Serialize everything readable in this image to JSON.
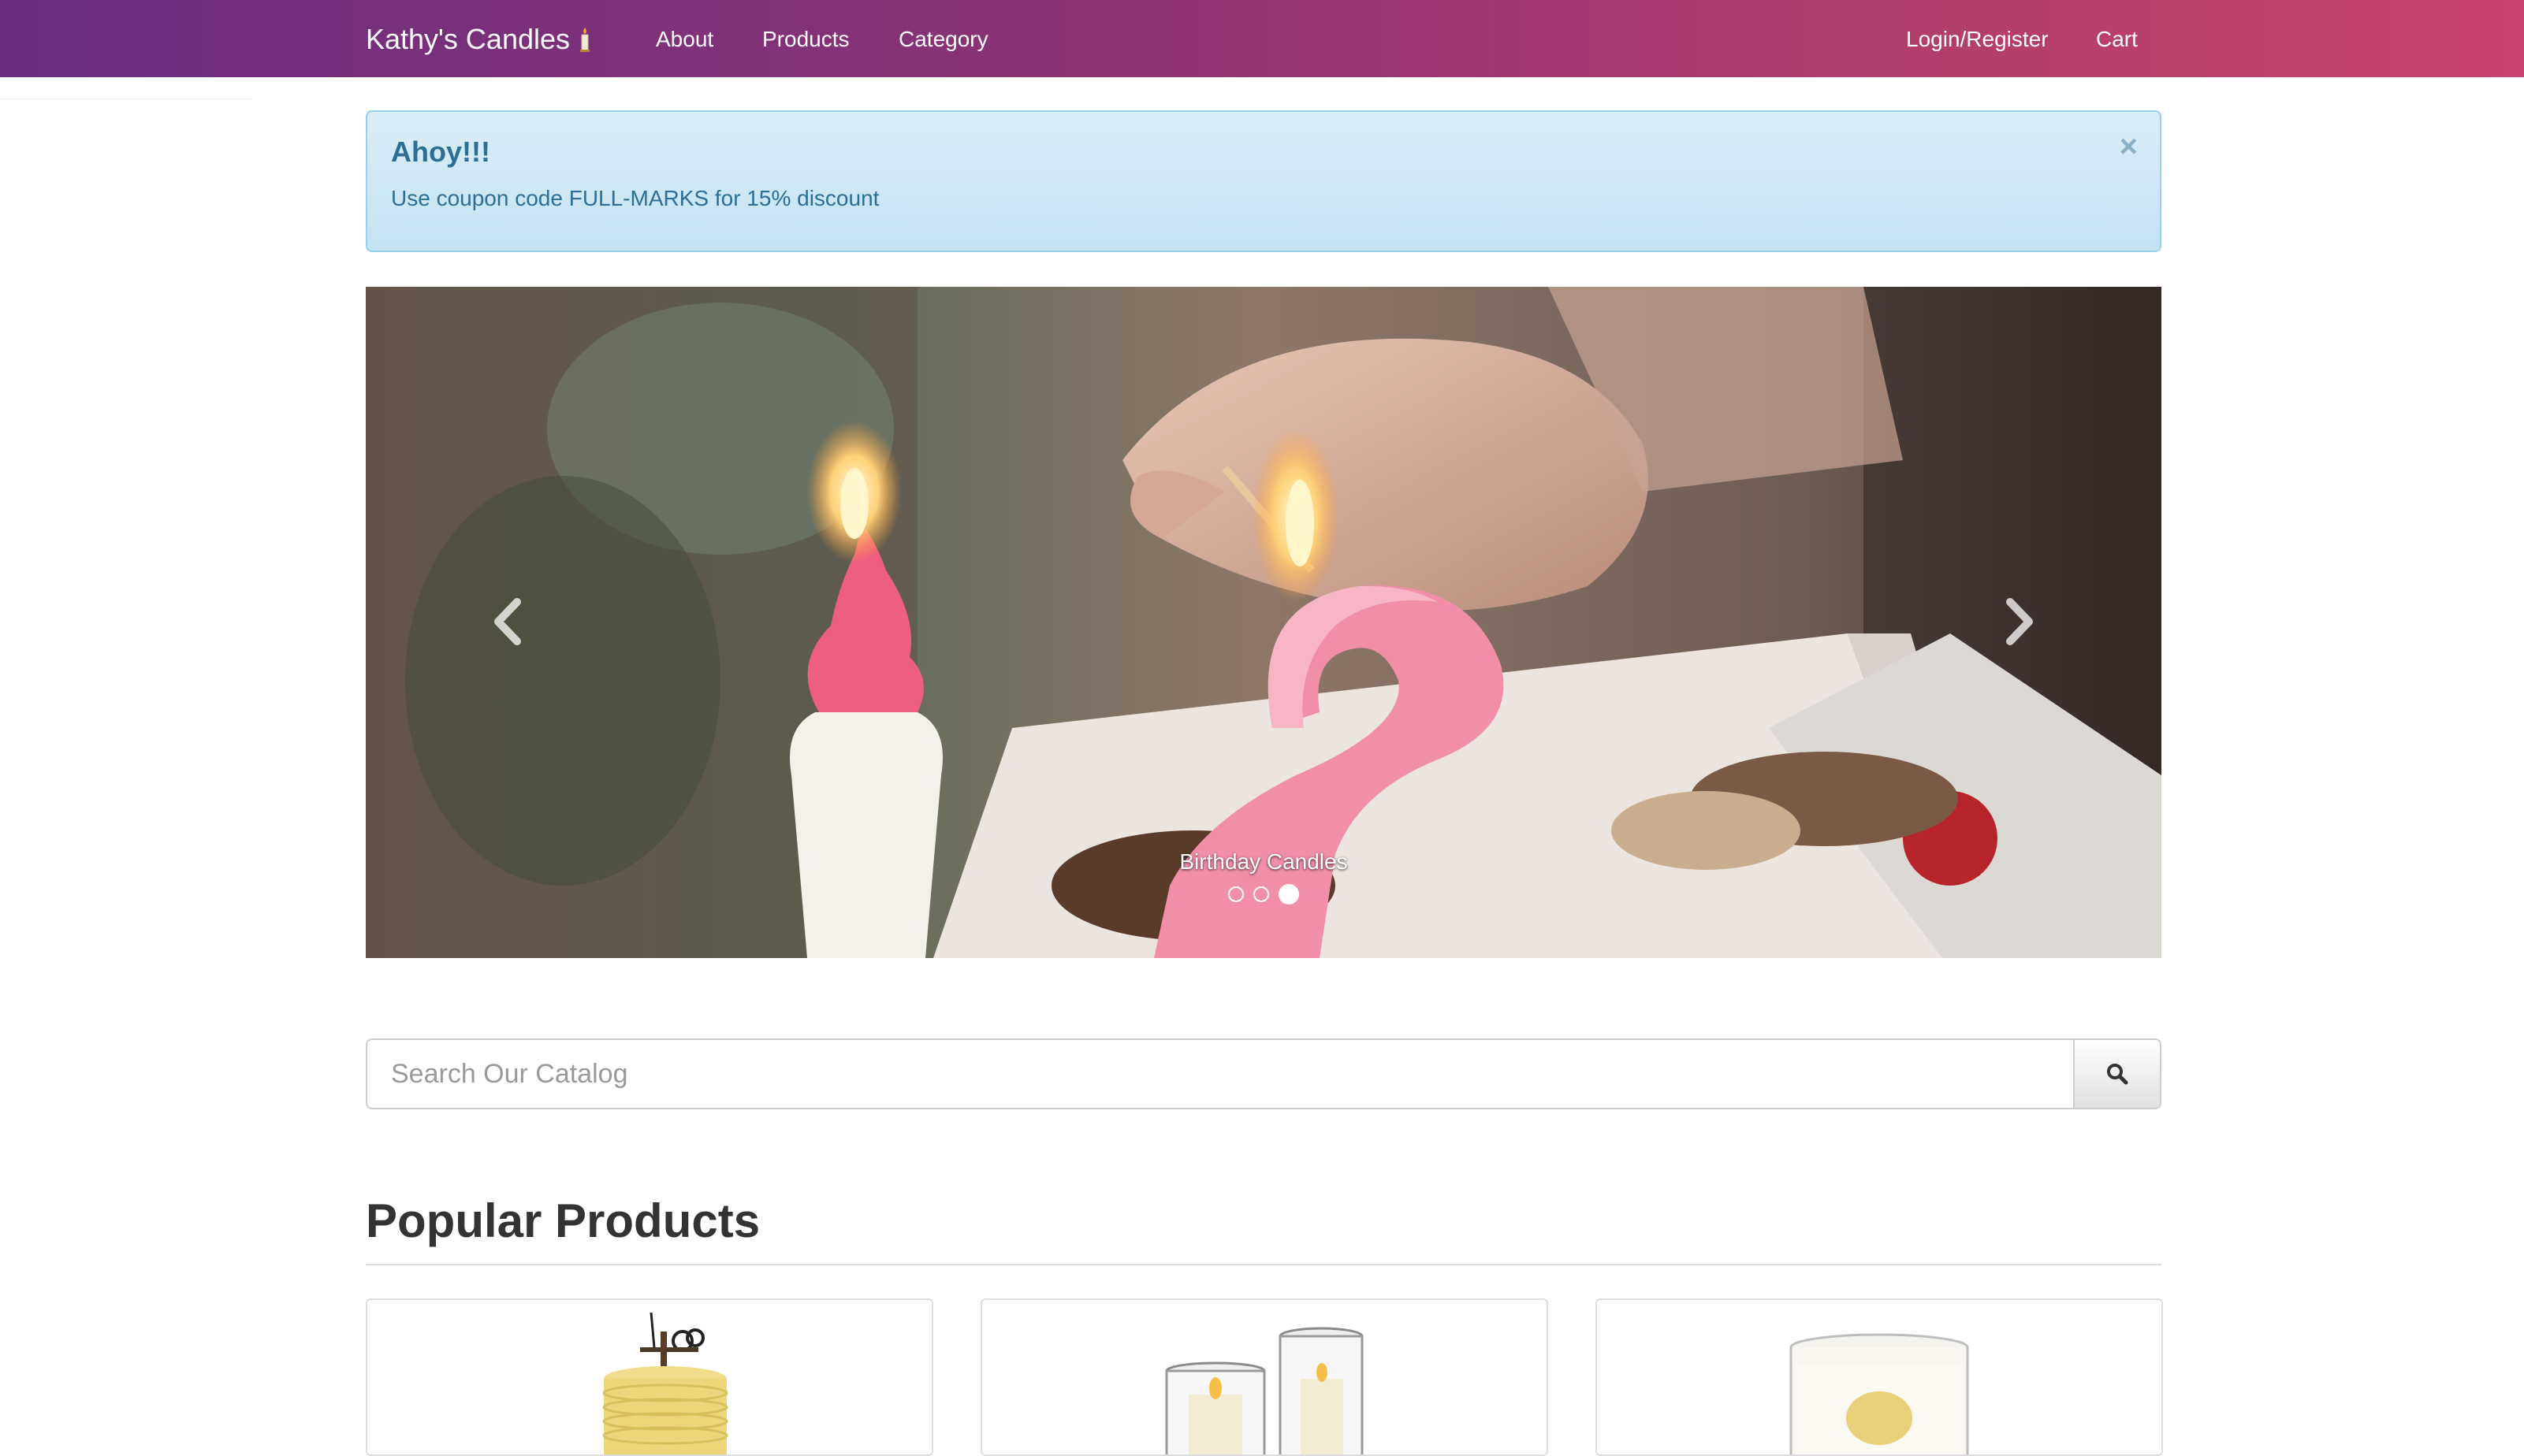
{
  "navbar": {
    "brand": "Kathy's Candles",
    "links": [
      "About",
      "Products",
      "Category"
    ],
    "right_links": [
      "Login/Register",
      "Cart"
    ],
    "gradient": [
      "#6a2e7f",
      "#c8436d"
    ]
  },
  "alert": {
    "title": "Ahoy!!!",
    "message": "Use coupon code FULL-MARKS for 15% discount",
    "close": "×"
  },
  "carousel": {
    "caption": "Birthday Candles",
    "slide_count": 3,
    "active_index": 2
  },
  "search": {
    "placeholder": "Search Our Catalog"
  },
  "popular": {
    "title": "Popular Products",
    "products": [
      {
        "image": "beeswax-spiral-candle"
      },
      {
        "image": "glass-hurricane-candles"
      },
      {
        "image": "jar-candle"
      }
    ]
  },
  "icons": {
    "brand": "candle-icon",
    "prev": "chevron-left-icon",
    "next": "chevron-right-icon",
    "search": "search-icon"
  }
}
